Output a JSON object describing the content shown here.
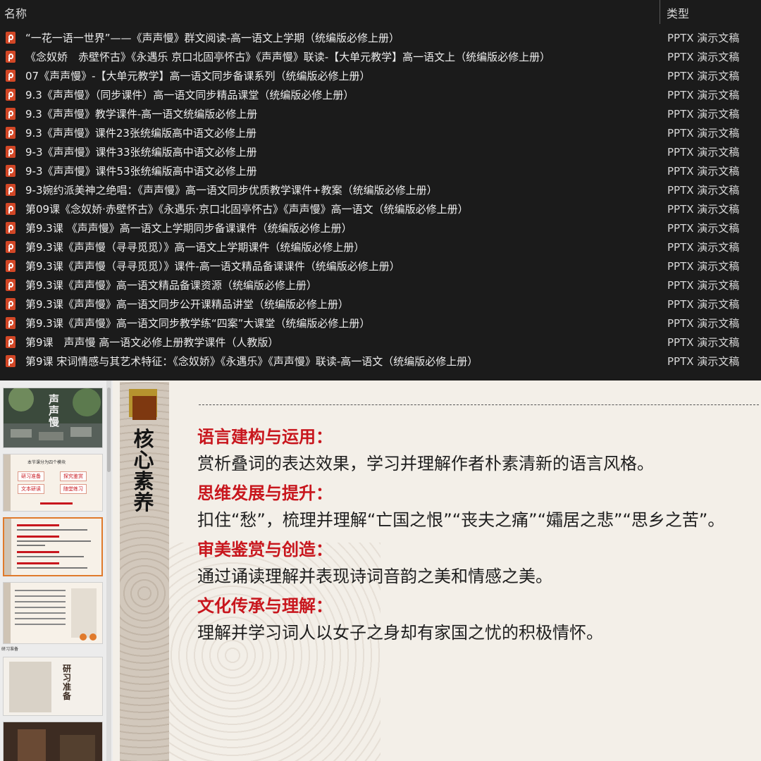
{
  "explorer": {
    "col_name": "名称",
    "col_type": "类型",
    "sort_glyph": "^",
    "files": [
      {
        "name": "“一花一语一世界”——《声声慢》群文阅读-高一语文上学期（统编版必修上册）",
        "type": "PPTX 演示文稿"
      },
      {
        "name": "《念奴娇　赤壁怀古》《永遇乐 京口北固亭怀古》《声声慢》联读-【大单元教学】高一语文上（统编版必修上册）",
        "type": "PPTX 演示文稿"
      },
      {
        "name": "07《声声慢》-【大单元教学】高一语文同步备课系列（统编版必修上册）",
        "type": "PPTX 演示文稿"
      },
      {
        "name": "9.3《声声慢》（同步课件）高一语文同步精品课堂（统编版必修上册）",
        "type": "PPTX 演示文稿"
      },
      {
        "name": "9.3《声声慢》教学课件-高一语文统编版必修上册",
        "type": "PPTX 演示文稿"
      },
      {
        "name": "9.3《声声慢》课件23张统编版高中语文必修上册",
        "type": "PPTX 演示文稿"
      },
      {
        "name": "9-3《声声慢》课件33张统编版高中语文必修上册",
        "type": "PPTX 演示文稿"
      },
      {
        "name": "9-3《声声慢》课件53张统编版高中语文必修上册",
        "type": "PPTX 演示文稿"
      },
      {
        "name": "9-3婉约派美神之绝唱：《声声慢》高一语文同步优质教学课件+教案（统编版必修上册）",
        "type": "PPTX 演示文稿"
      },
      {
        "name": "第09课《念奴娇·赤壁怀古》《永遇乐·京口北固亭怀古》《声声慢》高一语文（统编版必修上册）",
        "type": "PPTX 演示文稿"
      },
      {
        "name": "第9.3课 《声声慢》高一语文上学期同步备课课件（统编版必修上册）",
        "type": "PPTX 演示文稿"
      },
      {
        "name": "第9.3课《声声慢（寻寻觅觅）》高一语文上学期课件（统编版必修上册）",
        "type": "PPTX 演示文稿"
      },
      {
        "name": "第9.3课《声声慢（寻寻觅觅）》课件-高一语文精品备课课件（统编版必修上册）",
        "type": "PPTX 演示文稿"
      },
      {
        "name": "第9.3课《声声慢》高一语文精品备课资源（统编版必修上册）",
        "type": "PPTX 演示文稿"
      },
      {
        "name": "第9.3课《声声慢》高一语文同步公开课精品讲堂（统编版必修上册）",
        "type": "PPTX 演示文稿"
      },
      {
        "name": "第9.3课《声声慢》高一语文同步教学练“四案”大课堂（统编版必修上册）",
        "type": "PPTX 演示文稿"
      },
      {
        "name": "第9课　声声慢 高一语文必修上册教学课件（人教版）",
        "type": "PPTX 演示文稿"
      },
      {
        "name": "第9课 宋词情感与其艺术特征：《念奴娇》《永遇乐》《声声慢》联读-高一语文（统编版必修上册）",
        "type": "PPTX 演示文稿"
      }
    ]
  },
  "thumbnails": {
    "t1_title": "声声慢",
    "t2_lines": [
      "本节课分为四个模块",
      "研习准备",
      "探究鉴赏",
      "文本研读",
      "随堂练习"
    ],
    "t5_title": "研习准备",
    "label_under_t4": "研习准备"
  },
  "slide": {
    "vertical_title": "核心素养",
    "sections": [
      {
        "heading": "语言建构与运用：",
        "body": "赏析叠词的表达效果，学习并理解作者朴素清新的语言风格。"
      },
      {
        "heading": "思维发展与提升：",
        "body": "扣住“愁”，梳理并理解“亡国之恨”“丧夫之痛”“孀居之悲”“思乡之苦”。"
      },
      {
        "heading": "审美鉴赏与创造：",
        "body": "通过诵读理解并表现诗词音韵之美和情感之美。"
      },
      {
        "heading": "文化传承与理解：",
        "body": "理解并学习词人以女子之身却有家国之忧的积极情怀。"
      }
    ]
  },
  "colors": {
    "explorer_bg": "#1b1b1b",
    "pptx_icon": "#d24726",
    "heading_red": "#c8161d",
    "slide_bg": "#f3efe8",
    "selected_thumb_border": "#e07a2c"
  }
}
